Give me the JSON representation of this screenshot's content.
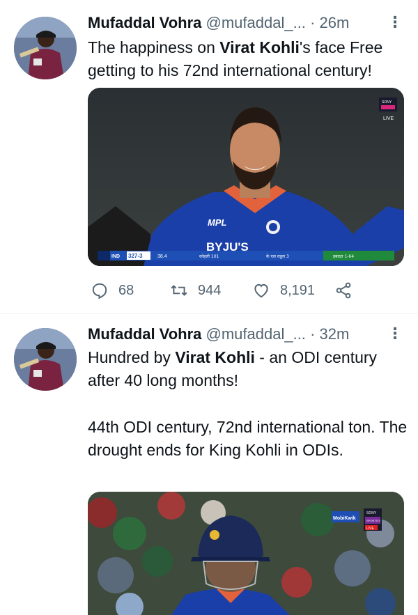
{
  "tweets": [
    {
      "author_name": "Mufaddal Vohra",
      "handle": "@mufaddal_...",
      "separator": "·",
      "time": "26m",
      "more_glyph": "⋮",
      "text": {
        "p1": "The happiness on ",
        "b1": "Virat Kohli",
        "p2": "'s face Free getting to his 72nd international century!"
      },
      "media": {
        "broadcaster_badge": "SONY",
        "live_label": "LIVE",
        "jersey_text": "MPL",
        "sponsor_text": "BYJU'S",
        "scorebar": {
          "team": "IND",
          "score": "327-3",
          "overs": "38.4",
          "batter1": "कोहली 101",
          "batter2": "के एल राहुल 3",
          "bowler": "इबादत 1-64"
        }
      },
      "stats": {
        "replies": "68",
        "retweets": "944",
        "likes": "8,191"
      },
      "icons": [
        "reply-icon",
        "retweet-icon",
        "like-icon",
        "share-icon"
      ]
    },
    {
      "author_name": "Mufaddal Vohra",
      "handle": "@mufaddal_...",
      "separator": "·",
      "time": "32m",
      "more_glyph": "⋮",
      "text": {
        "p1": "Hundred by ",
        "b1": "Virat Kohli",
        "p2": " - an ODI century after 40 long months!",
        "p3": "44th ODI century, 72nd international ton. The drought ends for King Kohli in ODIs."
      },
      "media": {
        "sponsor_logo": "MobiKwik",
        "broadcaster_badge": "SONY",
        "channel": "SPORTS 5",
        "live_label": "LIVE"
      }
    }
  ],
  "colors": {
    "text_primary": "#0f1419",
    "text_secondary": "#536471",
    "divider": "#eff3f4",
    "jersey_blue": "#1b3fa8",
    "scorebar_blue": "#1e4fb4"
  }
}
